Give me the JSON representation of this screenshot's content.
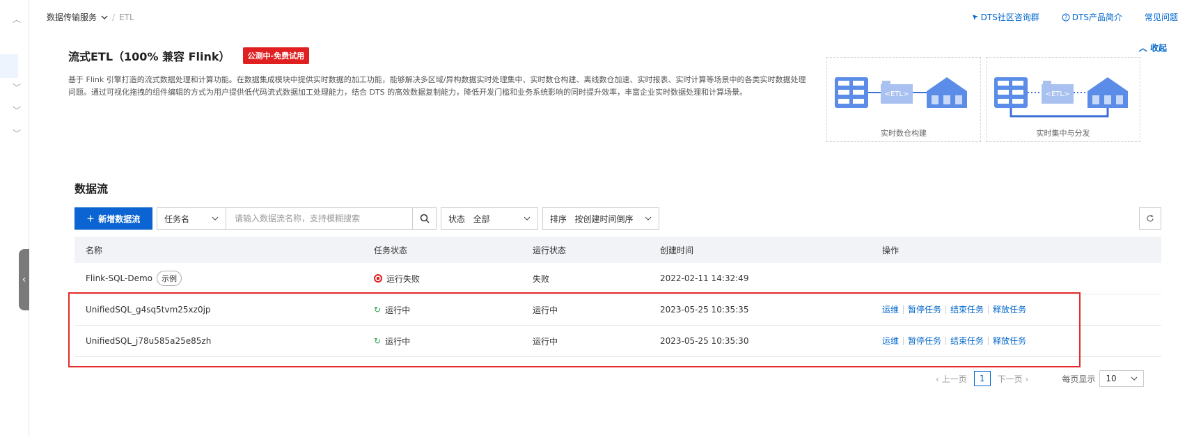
{
  "breadcrumb": {
    "main": "数据传输服务",
    "separator": "/",
    "current": "ETL"
  },
  "top_links": [
    {
      "label": "DTS社区咨询群",
      "icon": "pin-icon"
    },
    {
      "label": "DTS产品简介",
      "icon": "help-circle-icon"
    },
    {
      "label": "常见问题",
      "icon": ""
    }
  ],
  "intro": {
    "title": "流式ETL（100% 兼容 Flink）",
    "badge": "公测中-免费试用",
    "description": "基于 Flink 引擎打造的流式数据处理和计算功能。在数据集成模块中提供实时数据的加工功能，能够解决多区域/异构数据实时处理集中、实时数仓构建、离线数仓加速、实时报表、实时计算等场景中的各类实时数据处理问题。通过可视化拖拽的组件编辑的方式为用户提供低代码流式数据加工处理能力，结合 DTS 的高效数据复制能力，降低开发门槛和业务系统影响的同时提升效率，丰富企业实时数据处理和计算场景。",
    "collapse_label": "收起",
    "diagrams": [
      {
        "caption": "实时数仓构建",
        "etl_label": "<ETL>"
      },
      {
        "caption": "实时集中与分发",
        "etl_label": "<ETL>"
      }
    ]
  },
  "dataflow": {
    "title": "数据流",
    "new_button": "新增数据流",
    "filter_field": "任务名",
    "search_placeholder": "请输入数据流名称，支持模糊搜索",
    "status_label": "状态",
    "status_value": "全部",
    "sort_label": "排序",
    "sort_value": "按创建时间倒序"
  },
  "table": {
    "headers": [
      "名称",
      "任务状态",
      "运行状态",
      "创建时间",
      "操作"
    ],
    "rows": [
      {
        "name": "Flink-SQL-Demo",
        "tag": "示例",
        "task_status": "运行失败",
        "status_kind": "failed",
        "run_status": "失败",
        "created": "2022-02-11 14:32:49",
        "ops": []
      },
      {
        "name": "UnifiedSQL_g4sq5tvm25xz0jp",
        "tag": "",
        "task_status": "运行中",
        "status_kind": "running",
        "run_status": "运行中",
        "created": "2023-05-25 10:35:35",
        "ops": [
          "运维",
          "暂停任务",
          "结束任务",
          "释放任务"
        ]
      },
      {
        "name": "UnifiedSQL_j78u585a25e85zh",
        "tag": "",
        "task_status": "运行中",
        "status_kind": "running",
        "run_status": "运行中",
        "created": "2023-05-25 10:35:30",
        "ops": [
          "运维",
          "暂停任务",
          "结束任务",
          "释放任务"
        ]
      }
    ]
  },
  "pagination": {
    "prev": "上一页",
    "current_page": "1",
    "next": "下一页",
    "per_page_label": "每页显示",
    "per_page_value": "10"
  },
  "colors": {
    "primary": "#0b64d2",
    "link": "#0066cc",
    "badge": "#e02020",
    "highlight_box": "#e52b2b",
    "running": "#2da44e"
  }
}
